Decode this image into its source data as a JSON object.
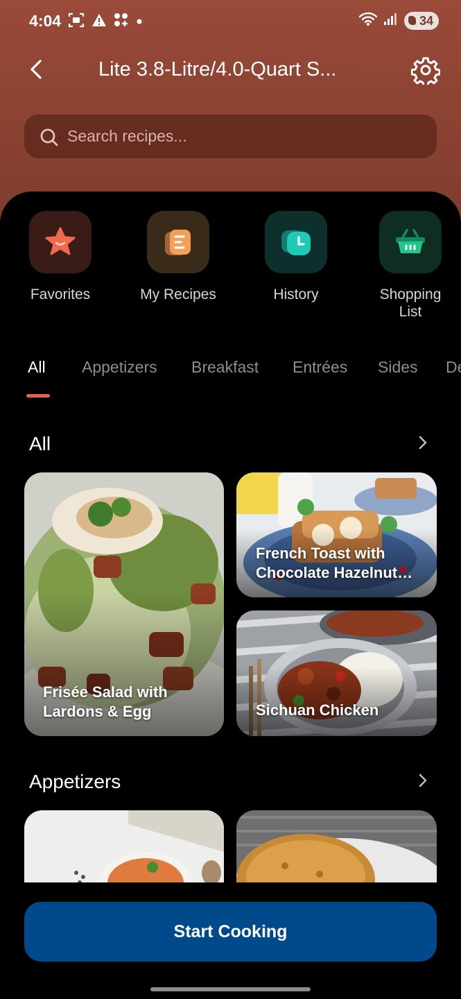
{
  "status_bar": {
    "time": "4:04",
    "battery": "34"
  },
  "topbar": {
    "title": "Lite 3.8-Litre/4.0-Quart S...",
    "back_icon": "chevron-left-icon",
    "settings_icon": "gear-icon"
  },
  "search": {
    "placeholder": "Search recipes..."
  },
  "quick_actions": [
    {
      "label": "Favorites",
      "icon": "star-icon",
      "color": "#ef6a4f"
    },
    {
      "label": "My Recipes",
      "icon": "recipe-note-icon",
      "color": "#f5a05a"
    },
    {
      "label": "History",
      "icon": "clock-icon",
      "color": "#1ec9b8"
    },
    {
      "label": "Shopping\nList",
      "icon": "basket-icon",
      "color": "#22c58a"
    }
  ],
  "tabs": [
    "All",
    "Appetizers",
    "Breakfast",
    "Entrées",
    "Sides",
    "De"
  ],
  "active_tab": "All",
  "sections": [
    {
      "title": "All",
      "recipes": [
        {
          "title": "Frisée Salad with\nLardons & Egg"
        },
        {
          "title": "French Toast with\nChocolate Hazelnut…"
        },
        {
          "title": "Sichuan Chicken"
        }
      ]
    },
    {
      "title": "Appetizers",
      "recipes": [
        {
          "title": ""
        },
        {
          "title": ""
        }
      ]
    }
  ],
  "start_button": {
    "label": "Start Cooking"
  },
  "colors": {
    "header": "#8a4232",
    "accent": "#e0664a",
    "primary_button": "#004a8c"
  }
}
